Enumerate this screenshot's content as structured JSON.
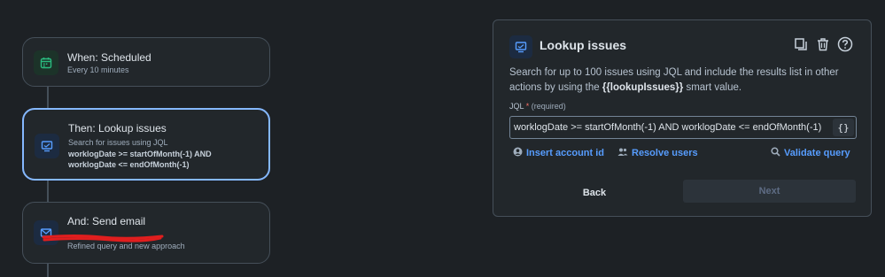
{
  "flow": {
    "trigger": {
      "title": "When: Scheduled",
      "subtitle": "Every 10 minutes",
      "icon": "calendar-icon",
      "color": "#2abb7f"
    },
    "action": {
      "title": "Then: Lookup issues",
      "subtitle": "Search for issues using JQL",
      "query_line1": "worklogDate >= startOfMonth(-1) AND",
      "query_line2": "worklogDate <= endOfMonth(-1)",
      "icon": "monitor-icon",
      "color": "#579dff"
    },
    "email": {
      "title": "And: Send email",
      "subtitle": "Refined query and new approach",
      "icon": "mail-icon",
      "color": "#579dff"
    }
  },
  "panel": {
    "title": "Lookup issues",
    "desc_before": "Search for up to 100 issues using JQL and include the results list in other actions by using the ",
    "desc_smart": "{{lookupIssues}}",
    "desc_after": " smart value.",
    "jql_label": "JQL",
    "required_mark": "*",
    "required_text": "(required)",
    "jql_value": "worklogDate >= startOfMonth(-1) AND worklogDate <= endOfMonth(-1)",
    "smart_button": "{}",
    "links": {
      "insert_account": "Insert account id",
      "resolve_users": "Resolve users",
      "validate_query": "Validate query"
    },
    "back_label": "Back",
    "next_label": "Next"
  },
  "colors": {
    "background": "#1d2125",
    "accent": "#579dff",
    "selected_border": "#85b8ff"
  }
}
